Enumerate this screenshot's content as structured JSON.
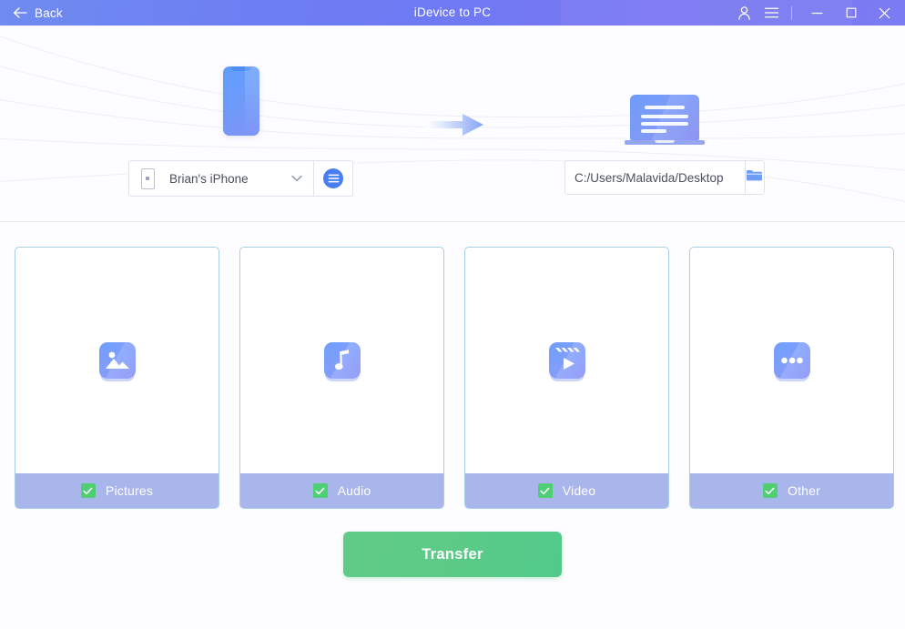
{
  "titlebar": {
    "back_label": "Back",
    "back_icon": "arrow-left-icon",
    "title": "iDevice to PC",
    "account_icon": "user-account-icon",
    "menu_icon": "hamburger-menu-icon",
    "minimize_icon": "minimize-icon",
    "maximize_icon": "maximize-icon",
    "close_icon": "close-icon",
    "gradient_start": "#6f8cf0",
    "gradient_end": "#7b7bf3"
  },
  "hero": {
    "source_icon": "smartphone-icon",
    "arrow_icon": "transfer-arrow-icon",
    "destination_icon": "laptop-icon"
  },
  "source": {
    "device_icon": "phone-icon",
    "device_name": "Brian's iPhone",
    "chevron_icon": "chevron-down-icon",
    "list_button_icon": "device-list-icon"
  },
  "destination": {
    "path": "C:/Users/Malavida/Desktop",
    "placeholder": "C:/Users/Malavida/Desktop",
    "browse_icon": "folder-icon"
  },
  "categories": [
    {
      "id": "pictures",
      "label": "Pictures",
      "icon": "picture-icon",
      "checked": true
    },
    {
      "id": "audio",
      "label": "Audio",
      "icon": "music-note-icon",
      "checked": true
    },
    {
      "id": "video",
      "label": "Video",
      "icon": "video-clapper-icon",
      "checked": true
    },
    {
      "id": "other",
      "label": "Other",
      "icon": "ellipsis-icon",
      "checked": true
    }
  ],
  "action": {
    "transfer_label": "Transfer",
    "transfer_color": "#5dcb85"
  },
  "colors": {
    "card_border": "#a9cfe6",
    "card_footer": "#a9b6ec",
    "checkbox_green": "#4fcf73",
    "accent_blue": "#4a7ef0"
  }
}
